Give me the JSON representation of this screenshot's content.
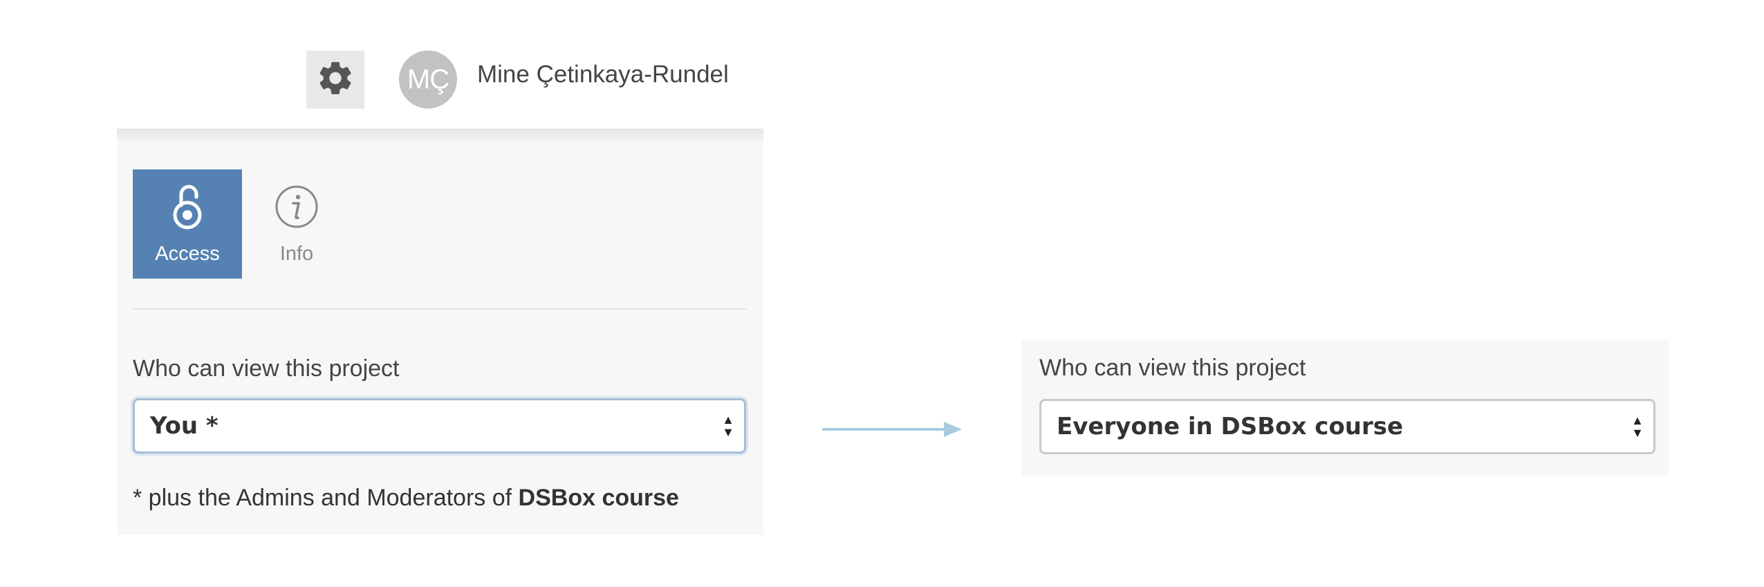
{
  "header": {
    "settings_icon": "gear-icon",
    "avatar_initials": "MÇ",
    "user_name": "Mine Çetinkaya-Rundel"
  },
  "tabs": [
    {
      "label": "Access",
      "icon": "open-padlock-icon",
      "active": true
    },
    {
      "label": "Info",
      "icon": "info-icon",
      "active": false
    }
  ],
  "access_panel": {
    "field_label": "Who can view this project",
    "selected_value": "You *",
    "note_prefix": "* plus the Admins and Moderators of ",
    "note_bold": "DSBox course"
  },
  "result_panel": {
    "field_label": "Who can view this project",
    "selected_value": "Everyone in DSBox course"
  },
  "colors": {
    "accent": "#5682b3",
    "arrow": "#a8cbe0",
    "panel_bg": "#f7f7f7"
  }
}
